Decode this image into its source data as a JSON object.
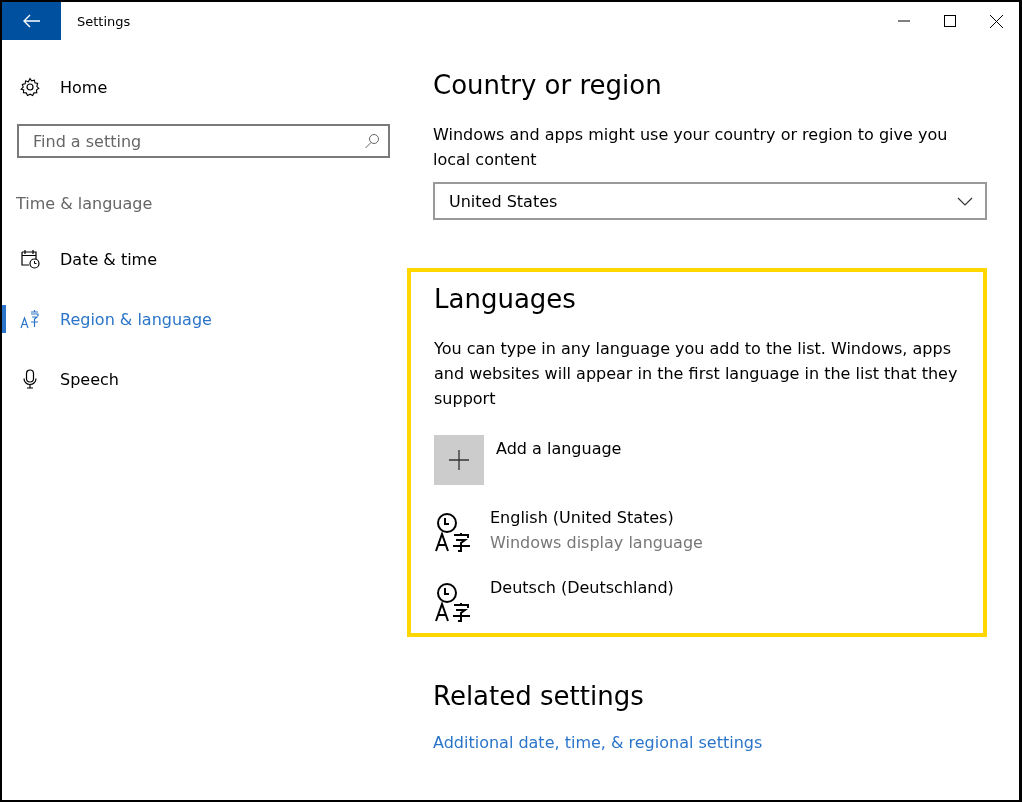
{
  "window": {
    "title": "Settings"
  },
  "sidebar": {
    "home": "Home",
    "search": {
      "placeholder": "Find a setting"
    },
    "group": "Time & language",
    "items": [
      {
        "label": "Date & time",
        "selected": false
      },
      {
        "label": "Region & language",
        "selected": true
      },
      {
        "label": "Speech",
        "selected": false
      }
    ]
  },
  "country": {
    "heading": "Country or region",
    "description": "Windows and apps might use your country or region to give you local content",
    "value": "United States"
  },
  "languages": {
    "heading": "Languages",
    "highlighted": true,
    "description": "You can type in any language you add to the list. Windows, apps and websites will appear in the first language in the list that they support",
    "add_label": "Add a language",
    "items": [
      {
        "name": "English (United States)",
        "note": "Windows display language"
      },
      {
        "name": "Deutsch (Deutschland)"
      }
    ]
  },
  "related": {
    "heading": "Related settings",
    "link": "Additional date, time, & regional settings"
  }
}
